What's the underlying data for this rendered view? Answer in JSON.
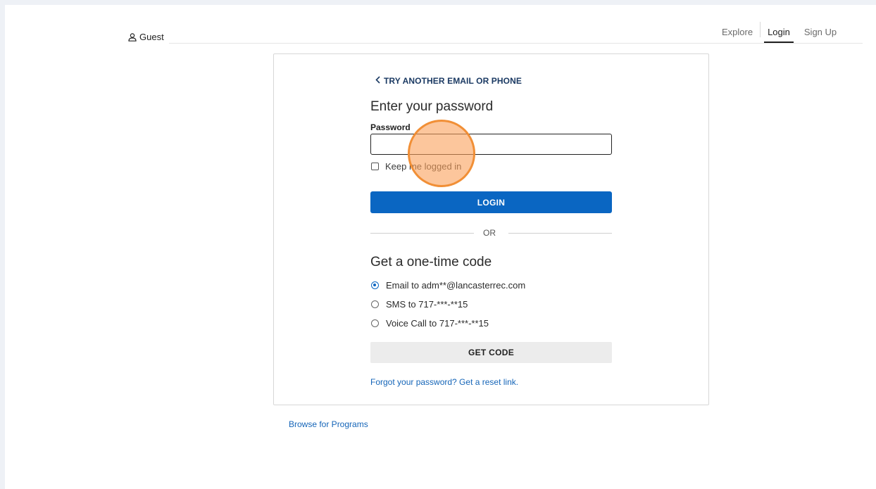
{
  "header": {
    "user_label": "Guest",
    "nav": {
      "explore": "Explore",
      "login": "Login",
      "signup": "Sign Up"
    }
  },
  "login": {
    "back_link": "TRY ANOTHER EMAIL OR PHONE",
    "heading": "Enter your password",
    "password_label": "Password",
    "password_value": "",
    "keep_logged_in": "Keep me logged in",
    "keep_logged_in_checked": false,
    "login_button": "LOGIN",
    "or_text": "OR"
  },
  "one_time_code": {
    "heading": "Get a one-time code",
    "options": [
      {
        "label": "Email to adm**@lancasterrec.com",
        "selected": true
      },
      {
        "label": "SMS to 717-***-**15",
        "selected": false
      },
      {
        "label": "Voice Call to 717-***-**15",
        "selected": false
      }
    ],
    "get_code_button": "GET CODE",
    "forgot_link": "Forgot your password? Get a reset link."
  },
  "footer": {
    "browse_link": "Browse for Programs"
  },
  "colors": {
    "primary": "#0a66c2",
    "link": "#1565b8",
    "click_marker": "#f08c32"
  }
}
